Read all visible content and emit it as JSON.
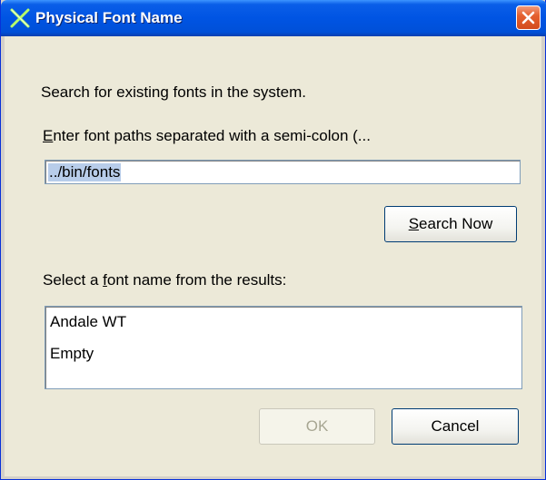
{
  "window": {
    "title": "Physical Font Name"
  },
  "dialog": {
    "description": "Search for existing fonts in the system.",
    "path_label_mnemonic": "E",
    "path_label_rest": "nter font paths separated with a semi-colon (...",
    "path_value": "../bin/fonts",
    "search_button_mnemonic": "S",
    "search_button_rest": "earch Now",
    "results_label_prefix": "Select a ",
    "results_label_mnemonic": "f",
    "results_label_rest": "ont name from the results:",
    "results": [
      "Andale WT",
      "Empty"
    ],
    "ok_label": "OK",
    "cancel_label": "Cancel"
  },
  "icons": {
    "title_icon": "x-logo-icon",
    "close_icon": "close-icon"
  },
  "colors": {
    "titlebar": "#0054e3",
    "close_button": "#e5612f",
    "dialog_background": "#ece9d8",
    "selection_highlight": "#b8cdea"
  }
}
